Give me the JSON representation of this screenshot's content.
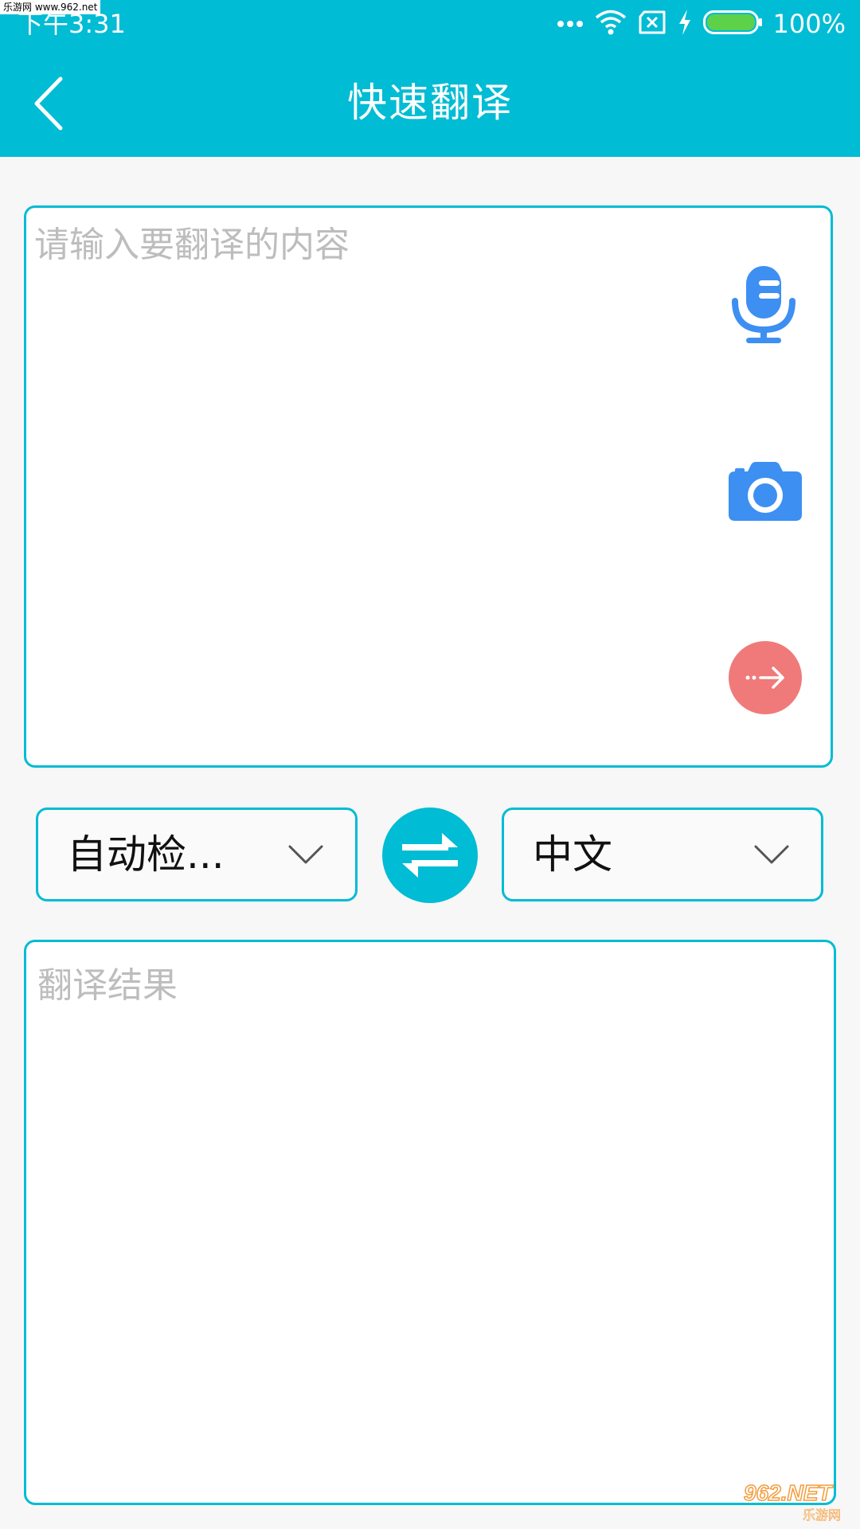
{
  "watermark_top": "乐游网 www.962.net",
  "status_bar": {
    "time": "下午3:31",
    "battery_text": "100%",
    "icons": [
      "more-dots-icon",
      "wifi-icon",
      "no-sim-icon",
      "charging-icon",
      "battery-icon"
    ]
  },
  "app_bar": {
    "back_icon": "chevron-left-icon",
    "title": "快速翻译"
  },
  "input": {
    "placeholder": "请输入要翻译的内容",
    "value": "",
    "actions": [
      "microphone-icon",
      "camera-icon",
      "arrow-right-icon"
    ]
  },
  "language": {
    "source_label": "自动检...",
    "target_label": "中文",
    "swap_icon": "swap-arrows-icon"
  },
  "result": {
    "placeholder": "翻译结果"
  },
  "watermark_bottom": {
    "main": "962.NET",
    "sub": "乐游网"
  },
  "colors": {
    "primary": "#00bcd4",
    "mic": "#3d8ff2",
    "camera": "#3d8ff2",
    "go_button": "#f07a7a",
    "background": "#f7f7f7",
    "placeholder": "#bdbdbd",
    "battery": "#5ed14b"
  }
}
